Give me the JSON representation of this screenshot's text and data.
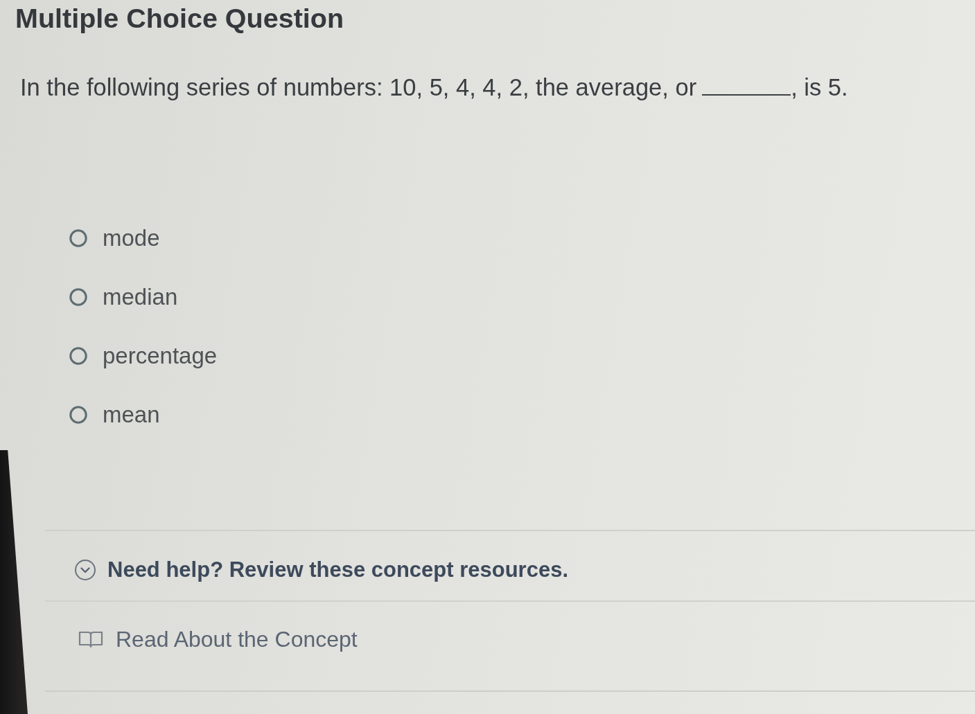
{
  "title": "Multiple Choice Question",
  "question": {
    "text_before_blank": "In the following series of numbers: 10, 5, 4, 4, 2, the average, or",
    "text_after_blank": ", is 5."
  },
  "options": [
    {
      "label": "mode",
      "selected": false
    },
    {
      "label": "median",
      "selected": false
    },
    {
      "label": "percentage",
      "selected": false
    },
    {
      "label": "mean",
      "selected": false
    }
  ],
  "help": {
    "toggle": "Need help? Review these concept resources.",
    "resources": [
      {
        "label": "Read About the Concept"
      }
    ]
  }
}
